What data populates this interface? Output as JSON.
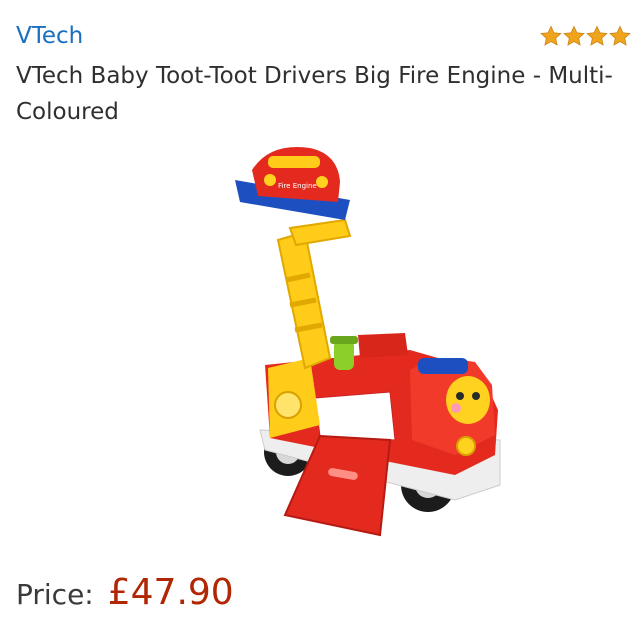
{
  "product": {
    "brand": "VTech",
    "rating_stars": 4,
    "title": "VTech Baby Toot-Toot Drivers Big Fire Engine - Multi-\nColoured",
    "image_label": "Fire Engine",
    "price_label": "Price:",
    "price_value": "£47.90"
  },
  "colors": {
    "brand_link": "#1a6fc2",
    "star": "#f0a41c",
    "price": "#b12704"
  }
}
